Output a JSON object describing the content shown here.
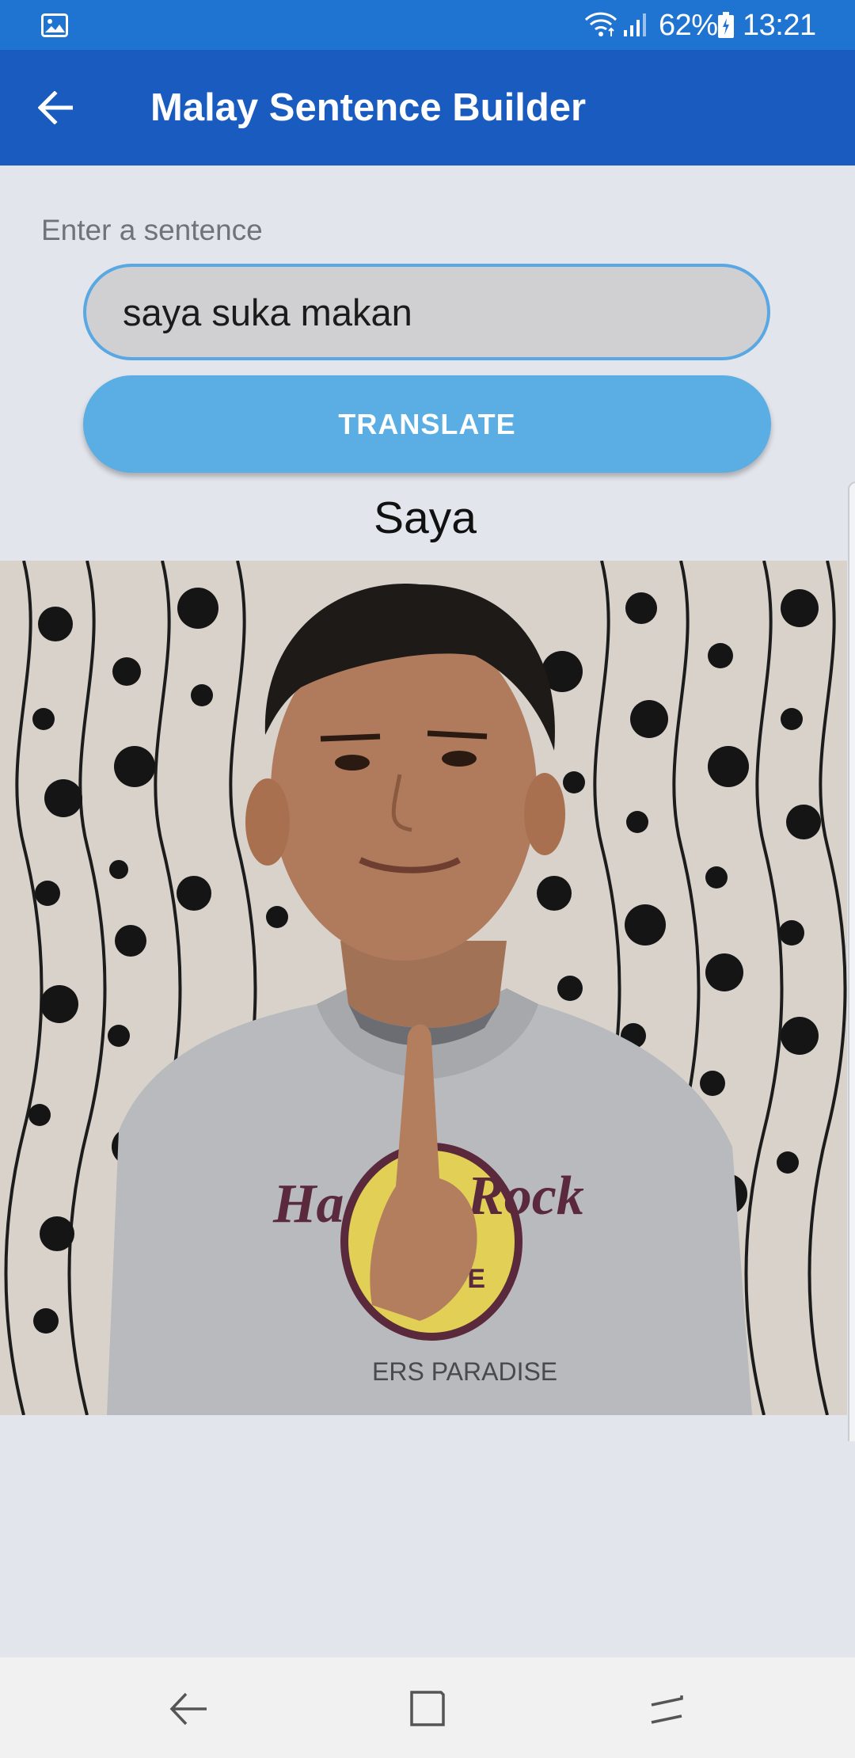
{
  "status_bar": {
    "battery_percent": "62%",
    "time": "13:21",
    "icons": [
      "gallery-icon",
      "wifi-icon",
      "signal-icon",
      "battery-icon"
    ]
  },
  "app_bar": {
    "title": "Malay Sentence Builder",
    "back_icon": "arrow-left-icon"
  },
  "form": {
    "label": "Enter a sentence",
    "input_value": "saya suka makan",
    "translate_label": "TRANSLATE"
  },
  "result": {
    "word": "Saya"
  },
  "nav_bar": {
    "icons": [
      "nav-back-icon",
      "nav-home-icon",
      "nav-recent-icon"
    ]
  },
  "colors": {
    "status_bar": "#1f74d2",
    "app_bar": "#1a5bbf",
    "background": "#e2e5ec",
    "input_border": "#59a8e3",
    "input_fill": "#d0d0d2",
    "button": "#5aaee3",
    "nav_bar": "#f1f1f1"
  }
}
